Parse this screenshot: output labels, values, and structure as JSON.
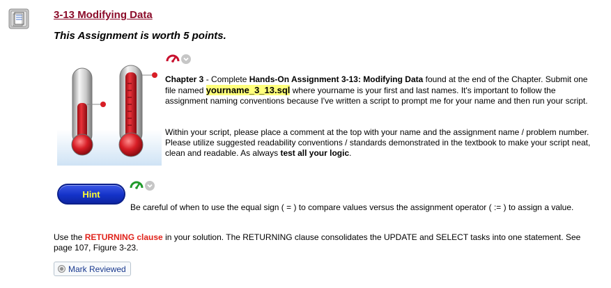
{
  "item": {
    "icon": "document-icon",
    "title": "3-13 Modifying Data",
    "worth": "This Assignment is worth 5 points."
  },
  "status_control": {
    "gauge_icon": "speedometer-icon",
    "chevron_icon": "chevron-down-icon",
    "gauge_color": "#c8102e"
  },
  "instructions": {
    "p1_a": "Chapter 3",
    "p1_b": " - Complete ",
    "p1_c": "Hands-On Assignment 3-13: Modifying Data",
    "p1_d": " found at the end of the Chapter. Submit one file named ",
    "p1_file": "yourname_3_13.sql",
    "p1_e": " where yourname is your first and last names.  It's important to follow the assignment naming conventions because I've written a script to prompt me for your name and then run your script.",
    "p2_a": "Within your script, please place a comment at the top with your name and the assignment name / problem number.  Please utilize suggested readability conventions / standards demonstrated in the textbook to make your script neat, clean and readable.  As always ",
    "p2_b": "test all your logic",
    "p2_c": "."
  },
  "hint": {
    "button_label": "Hint",
    "gauge_color": "#1f9a2a",
    "text": "Be careful of when to use the equal sign ( = ) to compare values versus the assignment operator ( := ) to assign a value."
  },
  "returning": {
    "a": "Use the ",
    "b": "RETURNING clause",
    "c": " in your solution.  The RETURNING clause consolidates the UPDATE and SELECT tasks into one statement.  See page 107, Figure 3-23."
  },
  "mark_reviewed": {
    "label": "Mark Reviewed",
    "icon": "radio-icon"
  },
  "colors": {
    "title": "#8b0c2a",
    "highlight": "#ffff7a",
    "hint_button": "#1432c8",
    "hint_label": "#ffff33",
    "emphasis_red": "#e0231b"
  }
}
